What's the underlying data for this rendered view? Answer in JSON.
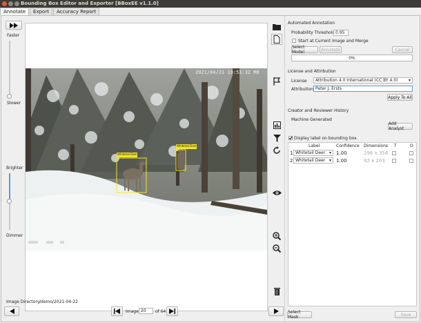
{
  "window": {
    "title": "Bounding Box Editor and Exporter [BBoxEE v1.1.0]"
  },
  "tabs": [
    {
      "label": "Annotate",
      "active": true
    },
    {
      "label": "Export",
      "active": false
    },
    {
      "label": "Accuracy Report",
      "active": false
    }
  ],
  "left": {
    "faster": "Faster",
    "slower": "Slower",
    "brighter": "Brighter",
    "dimmer": "Dimmer",
    "speed_level": 0.1,
    "brightness_level": 0.5
  },
  "photo": {
    "timestamp": "2021/04/21 19:53:32  M8",
    "boxes": [
      {
        "label": "Whitetail Deer"
      },
      {
        "label": "Whitetail Deer"
      }
    ]
  },
  "navigation": {
    "image_dir_label": "Image Directory:",
    "image_dir_value": "/demo/2021-04-22",
    "image_label": "Image:",
    "image_value": "20",
    "of_label": "of 64"
  },
  "automated": {
    "title": "Automated Annotation",
    "threshold_label": "Probability Threshold",
    "threshold_value": "0.95",
    "start_label": "Start at Current Image and Merge",
    "select_model": "Select Model",
    "annotate": "Annotate",
    "cancel": "Cancel",
    "progress": "0%"
  },
  "license": {
    "title": "License and Attribution",
    "license_label": "License",
    "license_value": "Attribution 4.0 International (CC BY 4.0)",
    "attribution_label": "Attribution",
    "attribution_value": "Peter J. Ersts",
    "apply_all": "Apply To All"
  },
  "history": {
    "title": "Creator and Reviewer History",
    "entry": "Machine Generated",
    "add_analyst": "Add Analyst"
  },
  "table": {
    "display_label": "Display label on bounding box",
    "columns": [
      "Label",
      "Confidence",
      "Dimensions",
      "T",
      "O"
    ],
    "rows": [
      {
        "index": "1",
        "label": "Whitetail Deer",
        "confidence": "1.00",
        "dimensions": "296 x 356"
      },
      {
        "index": "2",
        "label": "Whitetail Deer",
        "confidence": "1.00",
        "dimensions": "92 x 203"
      }
    ]
  },
  "footer": {
    "select_mask": "Select Mask",
    "save": "Save"
  },
  "colors": {
    "accent": "#5b9bd5",
    "box": "#f5e62a",
    "titlebar": "#3c3b37"
  }
}
